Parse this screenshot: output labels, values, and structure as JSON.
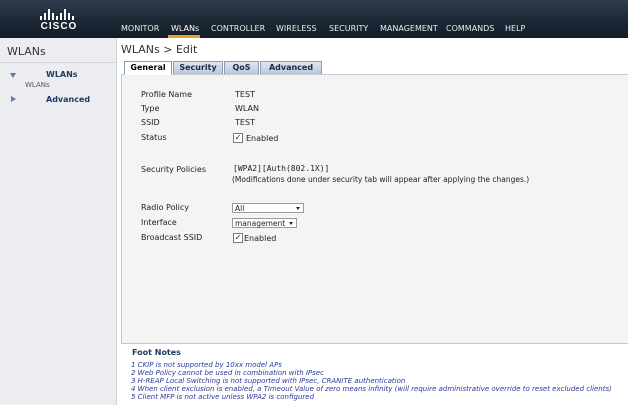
{
  "header": {
    "logo_text": "CISCO",
    "nav": [
      "MONITOR",
      "WLANs",
      "CONTROLLER",
      "WIRELESS",
      "SECURITY",
      "MANAGEMENT",
      "COMMANDS",
      "HELP"
    ],
    "active_nav": "WLANs"
  },
  "sidebar": {
    "title": "WLANs",
    "items": [
      {
        "label": "WLANs",
        "sub": "WLANs"
      },
      {
        "label": "Advanced"
      }
    ]
  },
  "main": {
    "title": "WLANs > Edit",
    "tabs": [
      "General",
      "Security",
      "QoS",
      "Advanced"
    ],
    "active_tab": "General",
    "fields": {
      "profile_name_label": "Profile Name",
      "profile_name_value": "TEST",
      "type_label": "Type",
      "type_value": "WLAN",
      "ssid_label": "SSID",
      "ssid_value": "TEST",
      "status_label": "Status",
      "status_value": "Enabled",
      "security_policies_label": "Security Policies",
      "security_policies_value": "[WPA2][Auth(802.1X)]",
      "security_note": "(Modifications done under security tab will appear after applying the changes.)",
      "radio_policy_label": "Radio Policy",
      "radio_policy_value": "All",
      "interface_label": "Interface",
      "interface_value": "management",
      "broadcast_ssid_label": "Broadcast SSID",
      "broadcast_ssid_value": "Enabled"
    }
  },
  "footnotes": {
    "title": "Foot Notes",
    "lines": [
      "1 CKIP is not supported by 10xx model APs",
      "2 Web Policy cannot be used in combination with IPsec",
      "3 H-REAP Local Switching is not supported with IPsec, CRANITE authentication",
      "4 When client exclusion is enabled, a Timeout Value of zero means infinity (will require administrative override to reset excluded clients)",
      "5 Client MFP is not active unless WPA2 is configured"
    ]
  },
  "colors": {
    "header_bg": "#1d2836",
    "active_underline": "#f0a020",
    "tab_bg": "#b9c7da",
    "footnote_text": "#2a3a9a"
  }
}
